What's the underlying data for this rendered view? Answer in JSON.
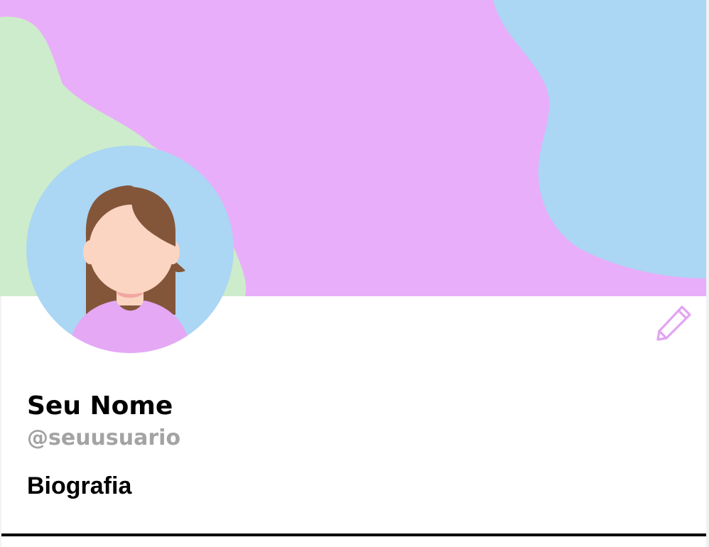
{
  "profile": {
    "name": "Seu Nome",
    "username": "@seuusuario",
    "bio": "Biografia"
  },
  "cover": {
    "background_color": "#e9aef9",
    "left_blob_color": "#cdeccc",
    "right_blob_color": "#abd6f4"
  },
  "avatar": {
    "background_color": "#abd6f4",
    "hair_color": "#83563a",
    "skin_color": "#fbd5c2",
    "shirt_color": "#e5a8f5"
  },
  "actions": {
    "edit_icon": "pencil-icon",
    "edit_icon_color": "#e2a4f2"
  },
  "colors": {
    "name_text": "#000000",
    "username_text": "#a3a3a3",
    "divider": "#000000"
  }
}
